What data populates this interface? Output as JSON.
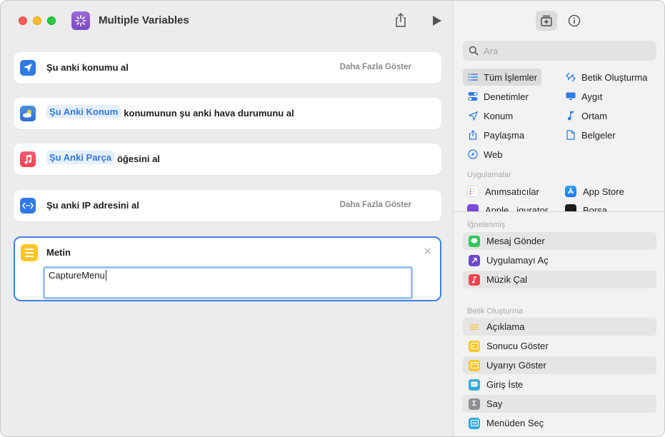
{
  "window": {
    "title": "Multiple Variables"
  },
  "actions": [
    {
      "id": "location",
      "label": "Şu anki konumu al",
      "more": "Daha Fazla Göster"
    },
    {
      "id": "weather",
      "token": "Şu Anki Konum",
      "label": "konumunun şu anki hava durumunu al"
    },
    {
      "id": "music",
      "token": "Şu Anki Parça",
      "label": "öğesini al"
    },
    {
      "id": "ip",
      "label": "Şu anki IP adresini al",
      "more": "Daha Fazla Göster"
    }
  ],
  "text_action": {
    "title": "Metin",
    "value": "CaptureMenu"
  },
  "sidebar": {
    "search_placeholder": "Ara",
    "categories_left": [
      "Tüm İşlemler",
      "Denetimler",
      "Konum",
      "Paylaşma",
      "Web"
    ],
    "categories_right": [
      "Betik Oluşturma",
      "Aygıt",
      "Ortam",
      "Belgeler"
    ],
    "apps_header": "Uygulamalar",
    "apps": [
      "Anımsatıcılar",
      "App Store",
      "Apple...igurator",
      "Borsa"
    ],
    "pinned_header": "İğnelenmiş",
    "pinned": [
      "Mesaj Gönder",
      "Uygulamayı Aç",
      "Müzik Çal"
    ],
    "scripting_header": "Betik Oluşturma",
    "scripting": [
      "Açıklama",
      "Sonucu Göster",
      "Uyarıyı Göster",
      "Giriş İste",
      "Say",
      "Menüden Seç"
    ]
  },
  "colors": {
    "accent": "#2f7ae5",
    "location": "#2f7ae5",
    "weather": "#3b82d9",
    "music": "#f0464f",
    "ip": "#2f7ae5",
    "text": "#fcc52c"
  }
}
